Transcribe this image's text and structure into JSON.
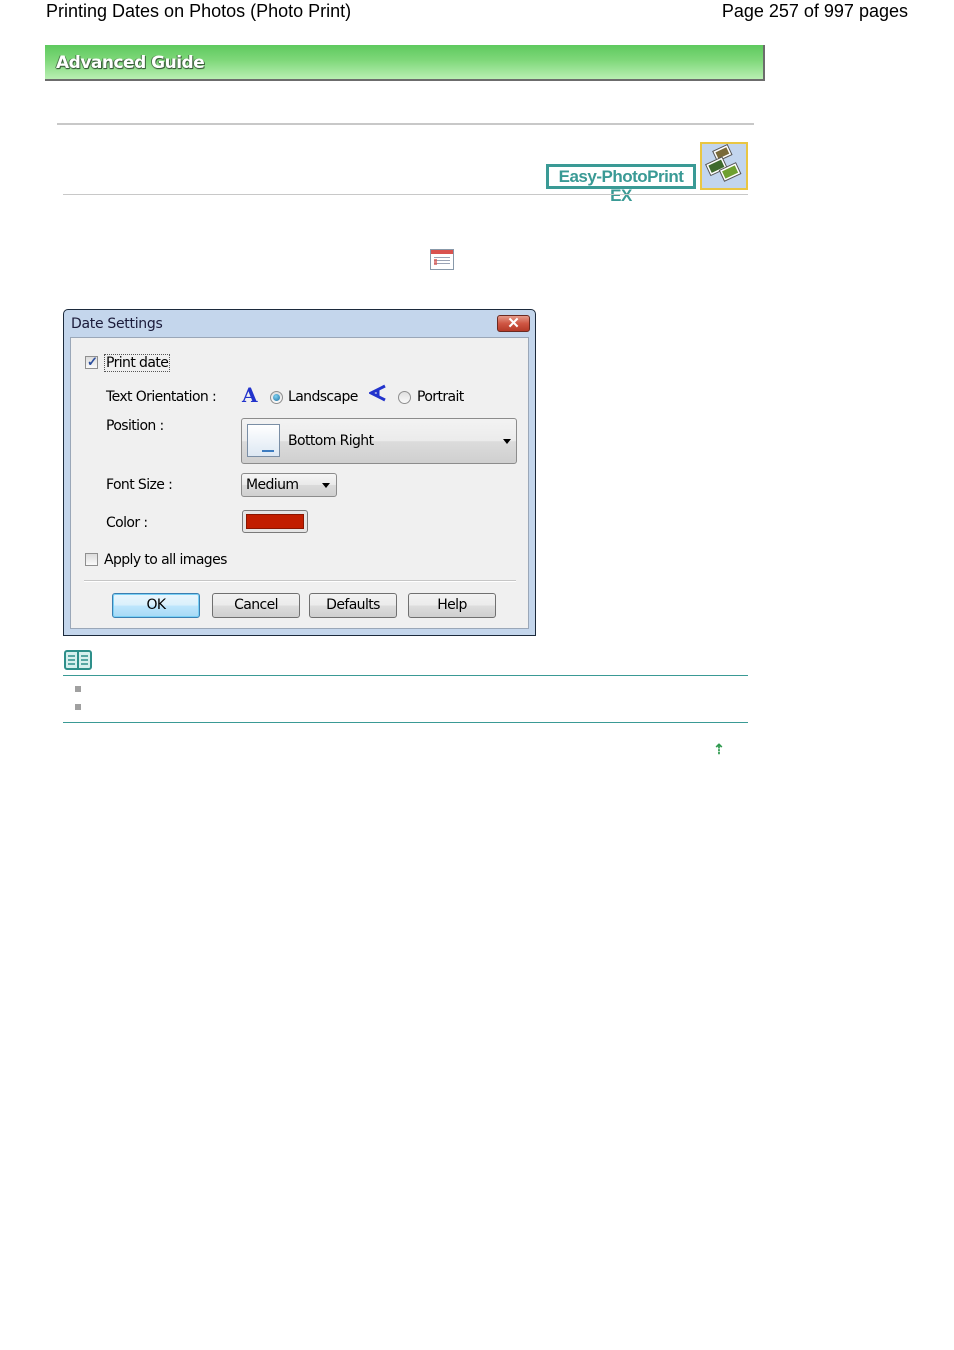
{
  "header": {
    "title": "Printing Dates on Photos (Photo Print)",
    "page_info": "Page 257 of 997 pages"
  },
  "banner": {
    "label": "Advanced Guide",
    "colors": {
      "top": "#5ec95e",
      "bottom": "#b9efb3"
    }
  },
  "app_badge": {
    "label": "Easy-PhotoPrint EX",
    "color": "#3a9a95",
    "icon": "photo-stack-icon"
  },
  "inline_icon": "date-settings-icon",
  "dialog": {
    "title": "Date Settings",
    "close_icon": "close-icon",
    "print_date": {
      "label": "Print date",
      "checked": true
    },
    "text_orientation": {
      "label": "Text Orientation :",
      "options": [
        {
          "label": "Landscape",
          "icon": "landscape-a-icon",
          "selected": true
        },
        {
          "label": "Portrait",
          "icon": "portrait-a-icon",
          "selected": false
        }
      ]
    },
    "position": {
      "label": "Position :",
      "value": "Bottom Right"
    },
    "font_size": {
      "label": "Font Size :",
      "value": "Medium"
    },
    "color": {
      "label": "Color :",
      "value": "#c21e00"
    },
    "apply_all": {
      "label": "Apply to all images",
      "checked": false
    },
    "buttons": {
      "ok": "OK",
      "cancel": "Cancel",
      "defaults": "Defaults",
      "help": "Help"
    }
  },
  "note": {
    "icon": "note-book-icon",
    "bullets": [
      "",
      ""
    ]
  },
  "back_to_top_icon": "up-arrow-icon"
}
